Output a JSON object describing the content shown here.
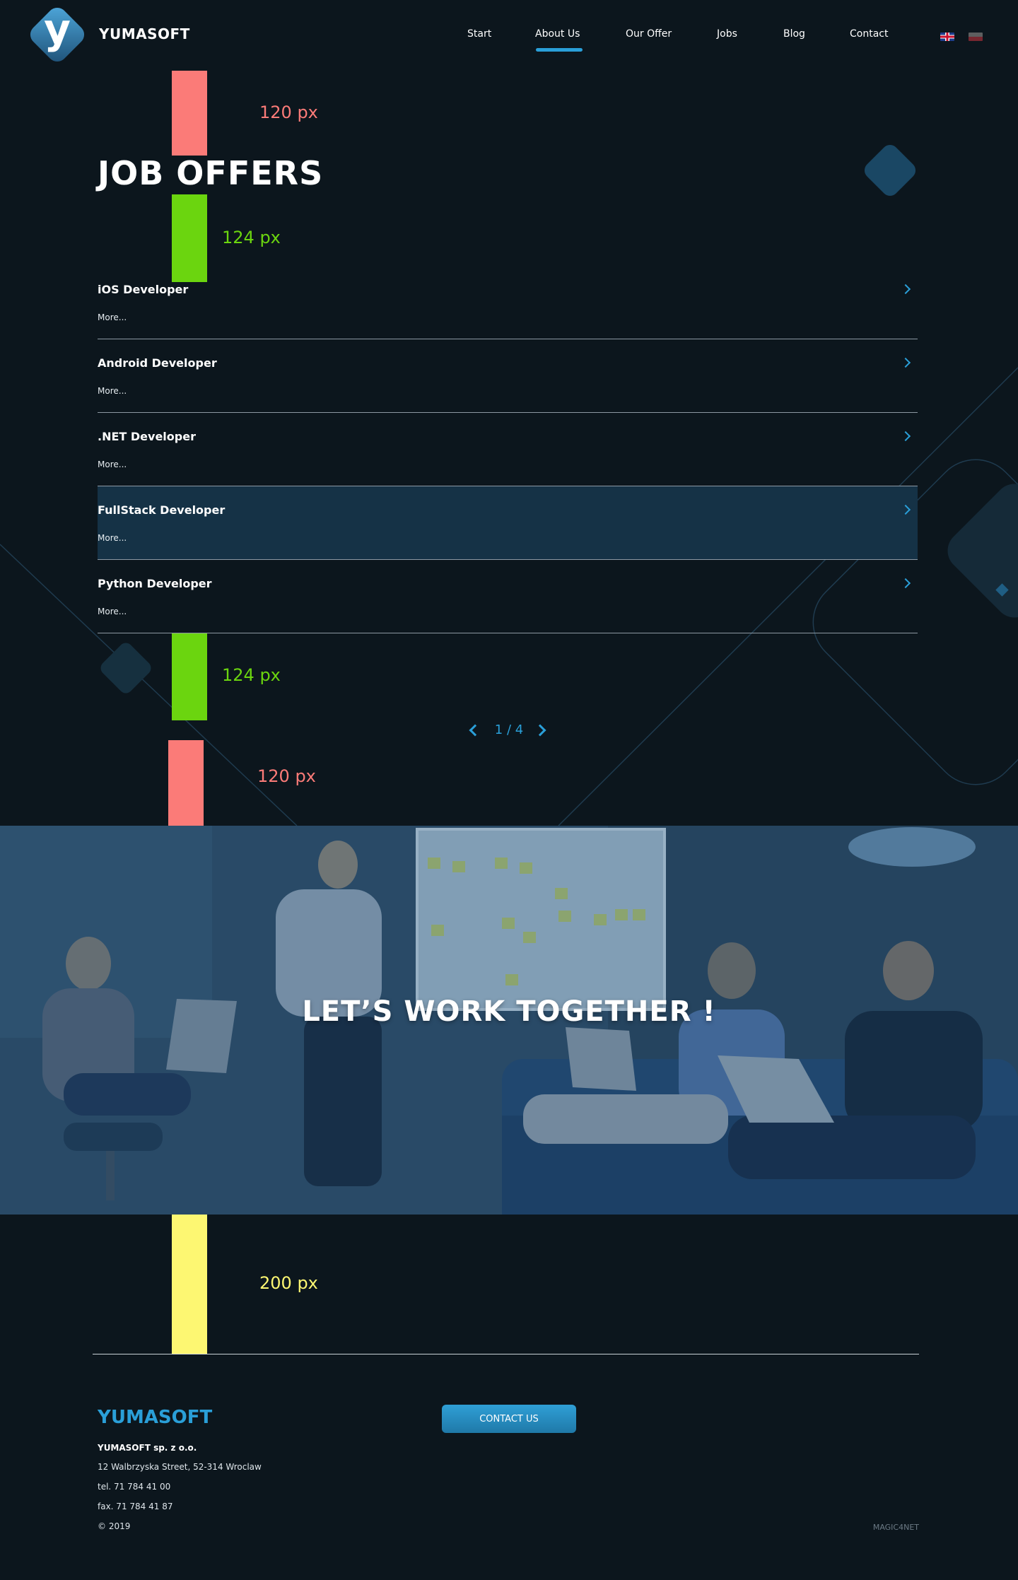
{
  "brand": {
    "name": "YUMASOFT",
    "logo_letter": "y"
  },
  "nav": {
    "items": [
      "Start",
      "About Us",
      "Our Offer",
      "Jobs",
      "Blog",
      "Contact"
    ],
    "active": "About Us"
  },
  "languages": [
    "English",
    "Polski"
  ],
  "markers": {
    "top_outer": "120 px",
    "top_inner": "124 px",
    "bottom_inner": "124 px",
    "bottom_outer": "120 px",
    "footer_gap": "200 px"
  },
  "jobs": {
    "title": "JOB OFFERS",
    "more_label": "More...",
    "items": [
      {
        "title": "iOS Developer"
      },
      {
        "title": "Android Developer"
      },
      {
        "title": ".NET Developer"
      },
      {
        "title": "FullStack Developer",
        "highlighted": true
      },
      {
        "title": "Python Developer"
      }
    ],
    "pager": {
      "text": "1 / 4"
    }
  },
  "banner": {
    "title": "LET’S WORK TOGETHER !"
  },
  "footer": {
    "brand": "YUMASOFT",
    "company": "YUMASOFT sp. z o.o.",
    "address": "12 Walbrzyska Street, 52-314 Wroclaw",
    "tel": "tel. 71 784 41 00",
    "fax": "fax. 71 784 41 87",
    "copyright": "© 2019",
    "contact_button": "CONTACT US",
    "credit": "MAGIC4NET"
  },
  "colors": {
    "background": "#0c161d",
    "accent": "#2a9fd8",
    "marker_red": "#fb7b78",
    "marker_green": "#6bd50f",
    "marker_yellow": "#fdf772",
    "highlight_row": "#153246"
  },
  "icons": {
    "job_arrow": "chevron-right-icon",
    "pager_prev": "chevron-left-icon",
    "pager_next": "chevron-right-icon"
  }
}
